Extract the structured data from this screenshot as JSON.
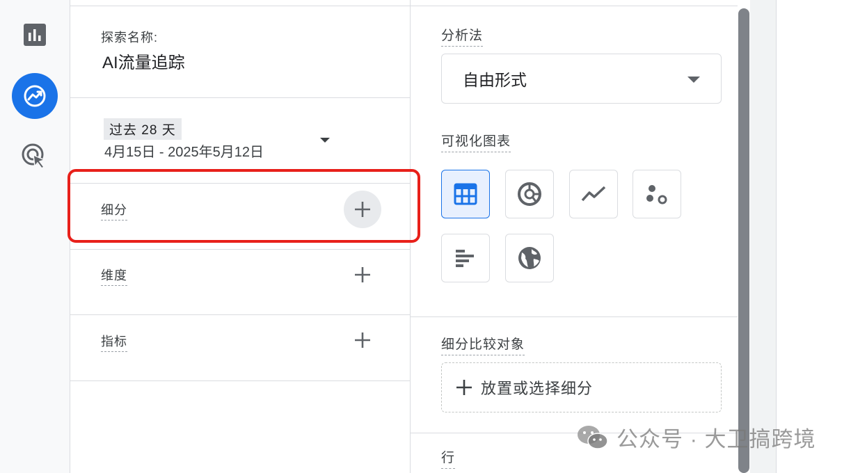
{
  "rail": {
    "icons": [
      "bar-chart-icon",
      "explore-trend-icon",
      "advertising-cursor-icon"
    ]
  },
  "variables": {
    "explore_name_label": "探索名称:",
    "explore_name_value": "AI流量追踪",
    "date_chip": "过去 28 天",
    "date_range": "4月15日 - 2025年5月12日",
    "segments_label": "细分",
    "dimensions_label": "维度",
    "metrics_label": "指标"
  },
  "settings": {
    "technique_label": "分析法",
    "technique_value": "自由形式",
    "visualization_label": "可视化图表",
    "visualizations": [
      "table-icon",
      "donut-chart-icon",
      "line-chart-icon",
      "scatter-icon",
      "bar-chart-horizontal-icon",
      "geo-map-icon"
    ],
    "segment_compare_label": "细分比较对象",
    "segment_drop_text": "放置或选择细分",
    "rows_label": "行"
  },
  "watermark": {
    "text": "公众号 · 大卫搞跨境"
  },
  "colors": {
    "accent": "#1a73e8",
    "highlight": "#e8201a"
  }
}
